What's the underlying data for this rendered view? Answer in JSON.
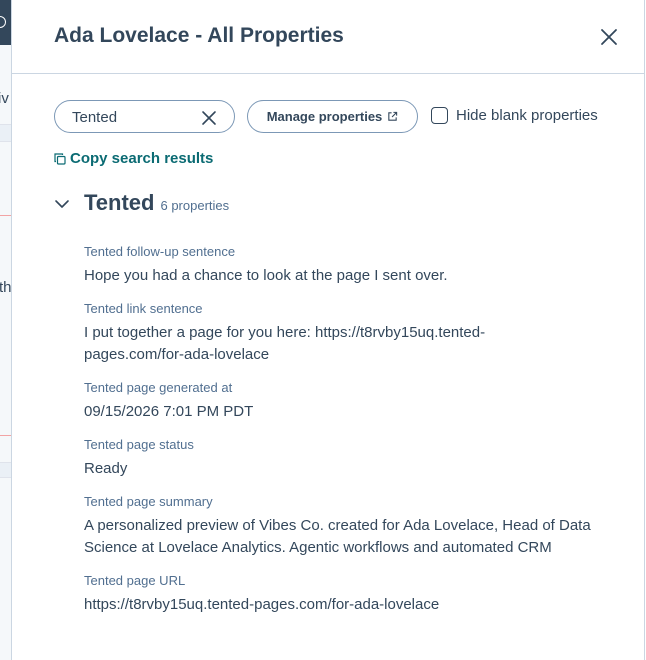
{
  "background": {
    "text_1": "iv",
    "text_2": "th"
  },
  "panel": {
    "title": "Ada Lovelace - All Properties",
    "close_label": "Close"
  },
  "toolbar": {
    "search_value": "Tented",
    "manage_label": "Manage properties",
    "hide_blank_label": "Hide blank properties",
    "hide_blank_checked": false
  },
  "copy_results_label": "Copy search results",
  "group": {
    "title": "Tented",
    "count": "6 properties",
    "properties": [
      {
        "label": "Tented follow-up sentence",
        "value": "Hope you had a chance to look at the page I sent over."
      },
      {
        "label": "Tented link sentence",
        "value": "I put together a page for you here: https://t8rvby15uq.tented-pages.com/for-ada-lovelace"
      },
      {
        "label": "Tented page generated at",
        "value": "09/15/2026 7:01 PM PDT"
      },
      {
        "label": "Tented page status",
        "value": "Ready"
      },
      {
        "label": "Tented page summary",
        "value": "A personalized preview of Vibes Co. created for Ada Lovelace, Head of Data Science at Lovelace Analytics. Agentic workflows and automated CRM"
      },
      {
        "label": "Tented page URL",
        "value": "https://t8rvby15uq.tented-pages.com/for-ada-lovelace"
      }
    ]
  },
  "colors": {
    "text": "#33475b",
    "muted": "#516f90",
    "link": "#0b6b73",
    "border": "#cbd6e2"
  }
}
